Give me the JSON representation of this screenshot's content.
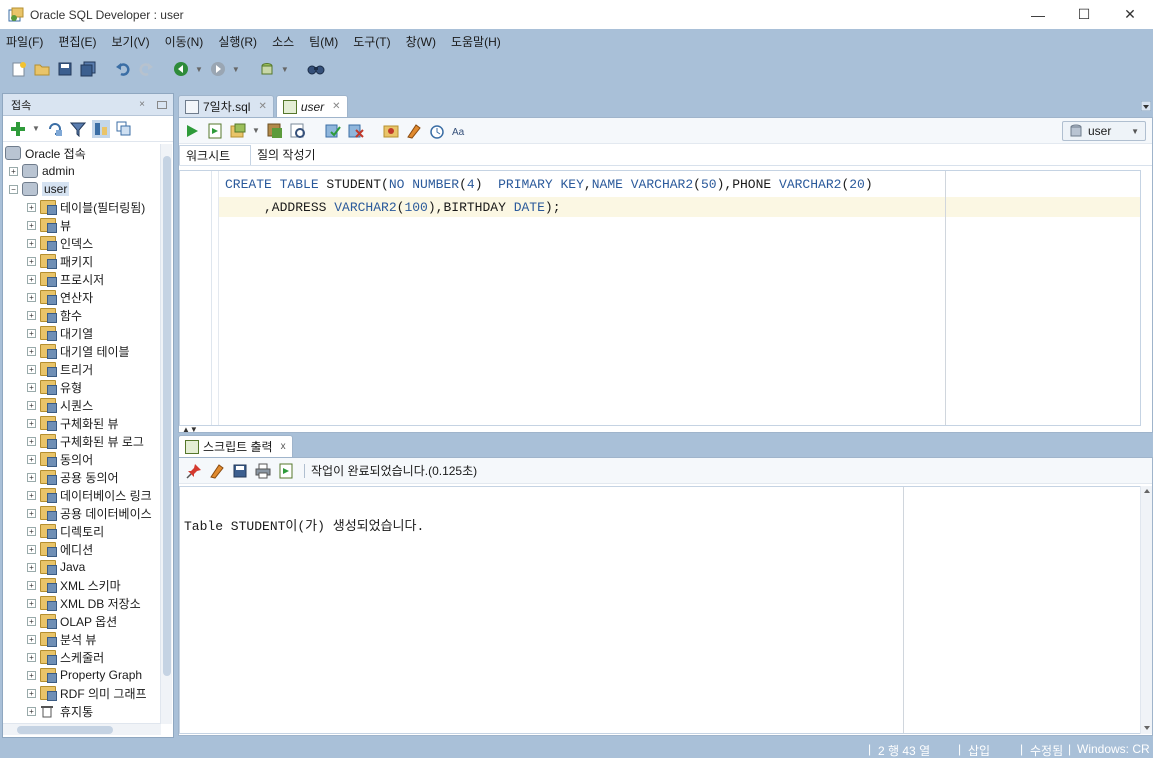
{
  "window": {
    "title": "Oracle SQL Developer : user",
    "minimize_glyph": "—",
    "maximize_glyph": "☐",
    "close_glyph": "✕"
  },
  "menu": [
    "파일(F)",
    "편집(E)",
    "보기(V)",
    "이동(N)",
    "실행(R)",
    "소스",
    "팀(M)",
    "도구(T)",
    "창(W)",
    "도움말(H)"
  ],
  "toolbar_icons": [
    "new-icon",
    "open-icon",
    "save-icon",
    "save-all-icon",
    "undo-icon",
    "redo-icon",
    "back-icon",
    "forward-icon",
    "sql-worksheet-icon",
    "find-icon"
  ],
  "connections_panel": {
    "title": "접속",
    "close": "×",
    "tree": [
      {
        "label": "Oracle 접속",
        "level": 0,
        "icon": "db",
        "expander": ""
      },
      {
        "label": "admin",
        "level": 1,
        "icon": "db",
        "expander": "+"
      },
      {
        "label": "user",
        "level": 1,
        "icon": "db",
        "expander": "−",
        "selected": true
      },
      {
        "label": "테이블(필터링됨)",
        "level": 2,
        "icon": "folder",
        "expander": "+"
      },
      {
        "label": "뷰",
        "level": 2,
        "icon": "folder",
        "expander": "+"
      },
      {
        "label": "인덱스",
        "level": 2,
        "icon": "folder",
        "expander": "+"
      },
      {
        "label": "패키지",
        "level": 2,
        "icon": "folder",
        "expander": "+"
      },
      {
        "label": "프로시저",
        "level": 2,
        "icon": "folder",
        "expander": "+"
      },
      {
        "label": "연산자",
        "level": 2,
        "icon": "folder",
        "expander": "+"
      },
      {
        "label": "함수",
        "level": 2,
        "icon": "folder",
        "expander": "+"
      },
      {
        "label": "대기열",
        "level": 2,
        "icon": "folder",
        "expander": "+"
      },
      {
        "label": "대기열 테이블",
        "level": 2,
        "icon": "folder",
        "expander": "+"
      },
      {
        "label": "트리거",
        "level": 2,
        "icon": "folder",
        "expander": "+"
      },
      {
        "label": "유형",
        "level": 2,
        "icon": "folder",
        "expander": "+"
      },
      {
        "label": "시퀀스",
        "level": 2,
        "icon": "folder",
        "expander": "+"
      },
      {
        "label": "구체화된 뷰",
        "level": 2,
        "icon": "folder",
        "expander": "+"
      },
      {
        "label": "구체화된 뷰 로그",
        "level": 2,
        "icon": "folder",
        "expander": "+"
      },
      {
        "label": "동의어",
        "level": 2,
        "icon": "folder",
        "expander": "+"
      },
      {
        "label": "공용 동의어",
        "level": 2,
        "icon": "folder",
        "expander": "+"
      },
      {
        "label": "데이터베이스 링크",
        "level": 2,
        "icon": "folder",
        "expander": "+"
      },
      {
        "label": "공용 데이터베이스",
        "level": 2,
        "icon": "folder",
        "expander": "+"
      },
      {
        "label": "디렉토리",
        "level": 2,
        "icon": "folder",
        "expander": "+"
      },
      {
        "label": "에디션",
        "level": 2,
        "icon": "folder",
        "expander": "+"
      },
      {
        "label": "Java",
        "level": 2,
        "icon": "folder",
        "expander": "+"
      },
      {
        "label": "XML 스키마",
        "level": 2,
        "icon": "folder",
        "expander": "+"
      },
      {
        "label": "XML DB 저장소",
        "level": 2,
        "icon": "folder",
        "expander": "+"
      },
      {
        "label": "OLAP 옵션",
        "level": 2,
        "icon": "folder",
        "expander": "+"
      },
      {
        "label": "분석 뷰",
        "level": 2,
        "icon": "folder",
        "expander": "+"
      },
      {
        "label": "스케줄러",
        "level": 2,
        "icon": "folder",
        "expander": "+"
      },
      {
        "label": "Property Graph",
        "level": 2,
        "icon": "folder",
        "expander": "+"
      },
      {
        "label": "RDF 의미 그래프",
        "level": 2,
        "icon": "folder",
        "expander": "+"
      },
      {
        "label": "휴지통",
        "level": 2,
        "icon": "trash",
        "expander": "+"
      }
    ]
  },
  "editor_tabs": [
    {
      "label": "7일차.sql",
      "active": false
    },
    {
      "label": "user",
      "active": true
    }
  ],
  "connection_select": "user",
  "worksheet_tabs": [
    "워크시트",
    "질의 작성기"
  ],
  "code": {
    "line1": [
      {
        "t": "CREATE TABLE ",
        "c": "kw"
      },
      {
        "t": "STUDENT",
        "c": "plain"
      },
      {
        "t": "(",
        "c": "plain"
      },
      {
        "t": "NO ",
        "c": "kw"
      },
      {
        "t": "NUMBER",
        "c": "kw"
      },
      {
        "t": "(",
        "c": "plain"
      },
      {
        "t": "4",
        "c": "num"
      },
      {
        "t": ")  ",
        "c": "plain"
      },
      {
        "t": "PRIMARY KEY",
        "c": "kw"
      },
      {
        "t": ",",
        "c": "plain"
      },
      {
        "t": "NAME ",
        "c": "kw"
      },
      {
        "t": "VARCHAR2",
        "c": "kw"
      },
      {
        "t": "(",
        "c": "plain"
      },
      {
        "t": "50",
        "c": "num"
      },
      {
        "t": "),PHONE ",
        "c": "plain"
      },
      {
        "t": "VARCHAR2",
        "c": "kw"
      },
      {
        "t": "(",
        "c": "plain"
      },
      {
        "t": "20",
        "c": "num"
      },
      {
        "t": ")",
        "c": "plain"
      }
    ],
    "line2": [
      {
        "t": "     ,ADDRESS ",
        "c": "plain"
      },
      {
        "t": "VARCHAR2",
        "c": "kw"
      },
      {
        "t": "(",
        "c": "plain"
      },
      {
        "t": "100",
        "c": "num"
      },
      {
        "t": "),BIRTHDAY ",
        "c": "plain"
      },
      {
        "t": "DATE",
        "c": "kw"
      },
      {
        "t": ");",
        "c": "plain"
      }
    ]
  },
  "output_panel": {
    "tab_label": "스크립트 출력",
    "tab_close": "x",
    "status": "작업이 완료되었습니다.(0.125초)",
    "text": "Table STUDENT이(가) 생성되었습니다."
  },
  "statusbar": {
    "position": "2 행 43 열",
    "mode": "삽입",
    "modified": "수정됨",
    "line_ending": "Windows: CR"
  },
  "colors": {
    "chrome": "#a9c0d8",
    "keyword": "#2b5a9b",
    "current_line": "#fbf7e3"
  }
}
